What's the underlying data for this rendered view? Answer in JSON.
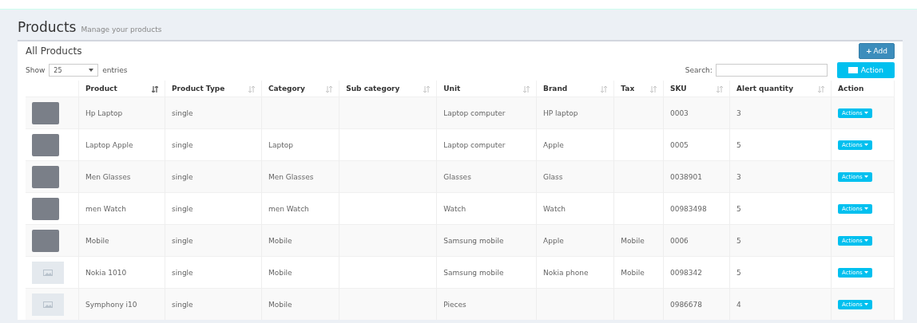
{
  "page": {
    "title": "Products",
    "subtitle": "Manage your products"
  },
  "box": {
    "title": "All Products",
    "add_button": {
      "icon": "+",
      "label": "Add"
    },
    "action_button": "Action"
  },
  "length": {
    "label_before": "Show",
    "value": "25",
    "label_after": "entries"
  },
  "search": {
    "label": "Search:"
  },
  "table": {
    "columns": [
      {
        "label": "Product",
        "sorted": true
      },
      {
        "label": "Product Type",
        "sorted": false
      },
      {
        "label": "Category",
        "sorted": false
      },
      {
        "label": "Sub category",
        "sorted": false
      },
      {
        "label": "Unit",
        "sorted": false
      },
      {
        "label": "Brand",
        "sorted": false
      },
      {
        "label": "Tax",
        "sorted": false
      },
      {
        "label": "SKU",
        "sorted": false
      },
      {
        "label": "Alert quantity",
        "sorted": false
      },
      {
        "label": "Action"
      }
    ],
    "rows": [
      {
        "kind": "photo",
        "product": "Hp Laptop",
        "type": "single",
        "category": "",
        "sub_category": "",
        "unit": "Laptop computer",
        "brand": "HP laptop",
        "tax": "",
        "sku": "0003",
        "alert": "3",
        "action": "Actions"
      },
      {
        "kind": "photo",
        "product": "Laptop Apple",
        "type": "single",
        "category": "Laptop",
        "sub_category": "",
        "unit": "Laptop computer",
        "brand": "Apple",
        "tax": "",
        "sku": "0005",
        "alert": "5",
        "action": "Actions"
      },
      {
        "kind": "photo",
        "product": "Men Glasses",
        "type": "single",
        "category": "Men Glasses",
        "sub_category": "",
        "unit": "Glasses",
        "brand": "Glass",
        "tax": "",
        "sku": "0038901",
        "alert": "3",
        "action": "Actions"
      },
      {
        "kind": "photo",
        "product": "men Watch",
        "type": "single",
        "category": "men Watch",
        "sub_category": "",
        "unit": "Watch",
        "brand": "Watch",
        "tax": "",
        "sku": "00983498",
        "alert": "5",
        "action": "Actions"
      },
      {
        "kind": "photo",
        "product": "Mobile",
        "type": "single",
        "category": "Mobile",
        "sub_category": "",
        "unit": "Samsung mobile",
        "brand": "Apple",
        "tax": "Mobile",
        "sku": "0006",
        "alert": "5",
        "action": "Actions"
      },
      {
        "kind": "placeholder",
        "product": "Nokia 1010",
        "type": "single",
        "category": "Mobile",
        "sub_category": "",
        "unit": "Samsung mobile",
        "brand": "Nokia phone",
        "tax": "Mobile",
        "sku": "0098342",
        "alert": "5",
        "action": "Actions"
      },
      {
        "kind": "placeholder",
        "product": "Symphony i10",
        "type": "single",
        "category": "Mobile",
        "sub_category": "",
        "unit": "Pieces",
        "brand": "",
        "tax": "",
        "sku": "0986678",
        "alert": "4",
        "action": "Actions"
      }
    ]
  }
}
